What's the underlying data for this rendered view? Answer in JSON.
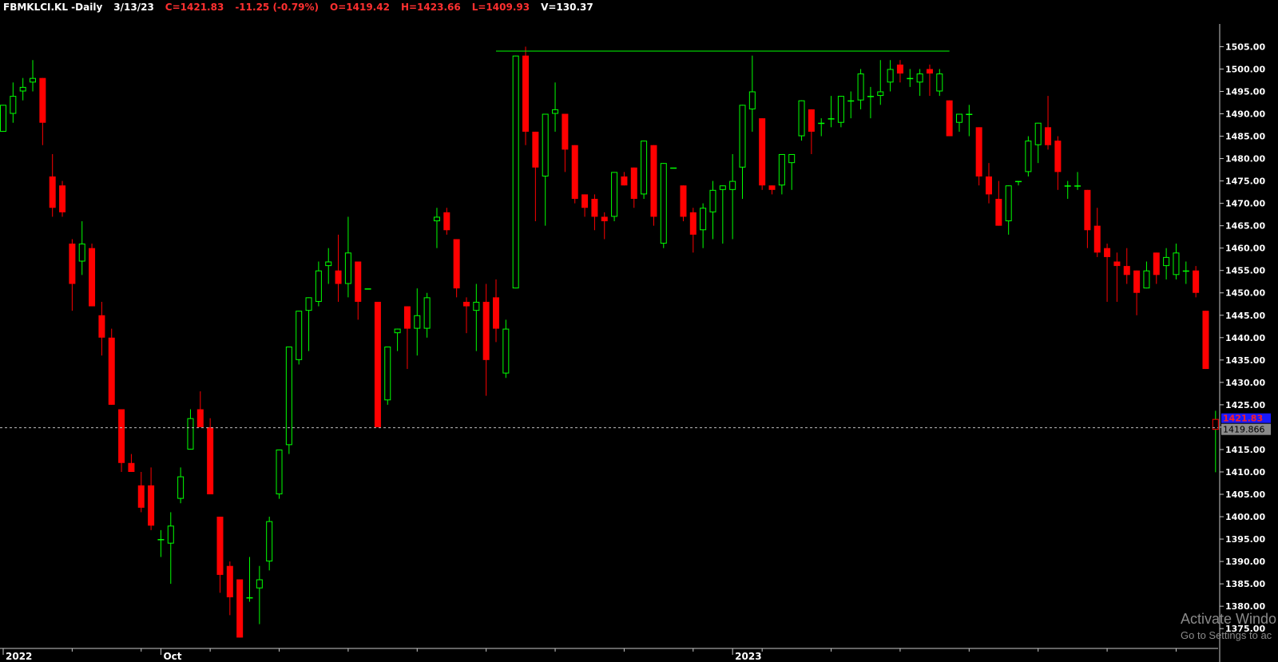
{
  "header": {
    "symbol": "FBMKLCI.KL -Daily",
    "date": "3/13/23",
    "close": "C=1421.83",
    "change": "-11.25 (-0.79%)",
    "open": "O=1419.42",
    "high": "H=1423.66",
    "low": "L=1409.93",
    "volume": "V=130.37"
  },
  "colors": {
    "background": "#000000",
    "up": "#00ff00",
    "down": "#ff0000",
    "resistance_line": "#00ff00",
    "text_white": "#ffffff",
    "text_red": "#ff3030",
    "price_badge_bg": "#8b8b8b"
  },
  "price_badges": {
    "last": "1421.83",
    "crosshair": "1419.866"
  },
  "watermark": {
    "line1": "Activate Windo",
    "line2": "Go to Settings to ac"
  },
  "chart_data": {
    "type": "candlestick",
    "ylim": [
      1372,
      1509
    ],
    "y_ticks": [
      "1375.00",
      "1380.00",
      "1385.00",
      "1390.00",
      "1395.00",
      "1400.00",
      "1405.00",
      "1410.00",
      "1415.00",
      "1420.00",
      "1425.00",
      "1430.00",
      "1435.00",
      "1440.00",
      "1445.00",
      "1450.00",
      "1455.00",
      "1460.00",
      "1465.00",
      "1470.00",
      "1475.00",
      "1480.00",
      "1485.00",
      "1490.00",
      "1495.00",
      "1500.00",
      "1505.00"
    ],
    "x_labels": [
      {
        "index": 0,
        "label": "2022"
      },
      {
        "index": 16,
        "label": "Oct"
      },
      {
        "index": 74,
        "label": "2023"
      }
    ],
    "horizontal_line": {
      "from_index": 50,
      "to_index": 96,
      "value": 1504
    },
    "crosshair_value": 1419.866,
    "candles": [
      {
        "o": 1486,
        "h": 1492,
        "l": 1486,
        "c": 1492
      },
      {
        "o": 1490,
        "h": 1497,
        "l": 1488,
        "c": 1494
      },
      {
        "o": 1495,
        "h": 1498,
        "l": 1493,
        "c": 1496
      },
      {
        "o": 1497,
        "h": 1502,
        "l": 1495,
        "c": 1498
      },
      {
        "o": 1498,
        "h": 1498,
        "l": 1483,
        "c": 1488
      },
      {
        "o": 1476,
        "h": 1481,
        "l": 1467,
        "c": 1469
      },
      {
        "o": 1474,
        "h": 1475,
        "l": 1467,
        "c": 1468
      },
      {
        "o": 1461,
        "h": 1462,
        "l": 1446,
        "c": 1452
      },
      {
        "o": 1457,
        "h": 1466,
        "l": 1454,
        "c": 1461
      },
      {
        "o": 1460,
        "h": 1461,
        "l": 1447,
        "c": 1447
      },
      {
        "o": 1445,
        "h": 1448,
        "l": 1436,
        "c": 1440
      },
      {
        "o": 1440,
        "h": 1442,
        "l": 1425,
        "c": 1425
      },
      {
        "o": 1424,
        "h": 1424,
        "l": 1410,
        "c": 1412
      },
      {
        "o": 1412,
        "h": 1414,
        "l": 1410,
        "c": 1410
      },
      {
        "o": 1407,
        "h": 1410,
        "l": 1401,
        "c": 1402
      },
      {
        "o": 1407,
        "h": 1411,
        "l": 1397,
        "c": 1398
      },
      {
        "o": 1395,
        "h": 1397,
        "l": 1391,
        "c": 1395
      },
      {
        "o": 1394,
        "h": 1401,
        "l": 1385,
        "c": 1398
      },
      {
        "o": 1404,
        "h": 1411,
        "l": 1403,
        "c": 1409
      },
      {
        "o": 1415,
        "h": 1424,
        "l": 1415,
        "c": 1422
      },
      {
        "o": 1424,
        "h": 1428,
        "l": 1420,
        "c": 1420
      },
      {
        "o": 1420,
        "h": 1422,
        "l": 1405,
        "c": 1405
      },
      {
        "o": 1400,
        "h": 1400,
        "l": 1383,
        "c": 1387
      },
      {
        "o": 1389,
        "h": 1390,
        "l": 1378,
        "c": 1382
      },
      {
        "o": 1386,
        "h": 1386,
        "l": 1373,
        "c": 1373
      },
      {
        "o": 1382,
        "h": 1391,
        "l": 1381,
        "c": 1382
      },
      {
        "o": 1384,
        "h": 1389,
        "l": 1376,
        "c": 1386
      },
      {
        "o": 1390,
        "h": 1400,
        "l": 1388,
        "c": 1399
      },
      {
        "o": 1405,
        "h": 1415,
        "l": 1404,
        "c": 1415
      },
      {
        "o": 1416,
        "h": 1438,
        "l": 1414,
        "c": 1438
      },
      {
        "o": 1435,
        "h": 1446,
        "l": 1434,
        "c": 1446
      },
      {
        "o": 1446,
        "h": 1449,
        "l": 1437,
        "c": 1449
      },
      {
        "o": 1448,
        "h": 1457,
        "l": 1447,
        "c": 1455
      },
      {
        "o": 1456,
        "h": 1460,
        "l": 1452,
        "c": 1457
      },
      {
        "o": 1455,
        "h": 1463,
        "l": 1448,
        "c": 1452
      },
      {
        "o": 1452,
        "h": 1467,
        "l": 1449,
        "c": 1459
      },
      {
        "o": 1457,
        "h": 1457,
        "l": 1444,
        "c": 1448
      },
      {
        "o": 1451,
        "h": 1451,
        "l": 1451,
        "c": 1451
      },
      {
        "o": 1448,
        "h": 1448,
        "l": 1420,
        "c": 1420
      },
      {
        "o": 1426,
        "h": 1438,
        "l": 1425,
        "c": 1438
      },
      {
        "o": 1441,
        "h": 1442,
        "l": 1437,
        "c": 1442
      },
      {
        "o": 1447,
        "h": 1447,
        "l": 1433,
        "c": 1442
      },
      {
        "o": 1442,
        "h": 1451,
        "l": 1436,
        "c": 1445
      },
      {
        "o": 1442,
        "h": 1450,
        "l": 1440,
        "c": 1449
      },
      {
        "o": 1466,
        "h": 1469,
        "l": 1460,
        "c": 1467
      },
      {
        "o": 1468,
        "h": 1469,
        "l": 1463,
        "c": 1464
      },
      {
        "o": 1462,
        "h": 1462,
        "l": 1449,
        "c": 1451
      },
      {
        "o": 1448,
        "h": 1449,
        "l": 1441,
        "c": 1447
      },
      {
        "o": 1446,
        "h": 1452,
        "l": 1437,
        "c": 1448
      },
      {
        "o": 1448,
        "h": 1452,
        "l": 1427,
        "c": 1435
      },
      {
        "o": 1449,
        "h": 1453,
        "l": 1439,
        "c": 1442
      },
      {
        "o": 1432,
        "h": 1444,
        "l": 1431,
        "c": 1442
      },
      {
        "o": 1451,
        "h": 1503,
        "l": 1451,
        "c": 1503
      },
      {
        "o": 1503,
        "h": 1505,
        "l": 1483,
        "c": 1486
      },
      {
        "o": 1486,
        "h": 1486,
        "l": 1466,
        "c": 1478
      },
      {
        "o": 1476,
        "h": 1490,
        "l": 1465,
        "c": 1490
      },
      {
        "o": 1490,
        "h": 1497,
        "l": 1486,
        "c": 1491
      },
      {
        "o": 1490,
        "h": 1490,
        "l": 1477,
        "c": 1482
      },
      {
        "o": 1483,
        "h": 1483,
        "l": 1470,
        "c": 1471
      },
      {
        "o": 1472,
        "h": 1472,
        "l": 1467,
        "c": 1469
      },
      {
        "o": 1471,
        "h": 1472,
        "l": 1464,
        "c": 1467
      },
      {
        "o": 1467,
        "h": 1468,
        "l": 1462,
        "c": 1466
      },
      {
        "o": 1467,
        "h": 1477,
        "l": 1466,
        "c": 1477
      },
      {
        "o": 1476,
        "h": 1477,
        "l": 1474,
        "c": 1474
      },
      {
        "o": 1478,
        "h": 1478,
        "l": 1469,
        "c": 1471
      },
      {
        "o": 1472,
        "h": 1484,
        "l": 1471,
        "c": 1484
      },
      {
        "o": 1483,
        "h": 1483,
        "l": 1465,
        "c": 1467
      },
      {
        "o": 1461,
        "h": 1479,
        "l": 1460,
        "c": 1479
      },
      {
        "o": 1478,
        "h": 1478,
        "l": 1478,
        "c": 1478
      },
      {
        "o": 1474,
        "h": 1474,
        "l": 1466,
        "c": 1467
      },
      {
        "o": 1468,
        "h": 1469,
        "l": 1459,
        "c": 1463
      },
      {
        "o": 1464,
        "h": 1470,
        "l": 1460,
        "c": 1469
      },
      {
        "o": 1468,
        "h": 1475,
        "l": 1462,
        "c": 1473
      },
      {
        "o": 1473,
        "h": 1474,
        "l": 1461,
        "c": 1474
      },
      {
        "o": 1473,
        "h": 1481,
        "l": 1462,
        "c": 1475
      },
      {
        "o": 1478,
        "h": 1492,
        "l": 1471,
        "c": 1492
      },
      {
        "o": 1491,
        "h": 1503,
        "l": 1486,
        "c": 1495
      },
      {
        "o": 1489,
        "h": 1489,
        "l": 1473,
        "c": 1474
      },
      {
        "o": 1474,
        "h": 1474,
        "l": 1472,
        "c": 1473
      },
      {
        "o": 1474,
        "h": 1481,
        "l": 1472,
        "c": 1481
      },
      {
        "o": 1479,
        "h": 1481,
        "l": 1473,
        "c": 1481
      },
      {
        "o": 1485,
        "h": 1493,
        "l": 1484,
        "c": 1493
      },
      {
        "o": 1491,
        "h": 1491,
        "l": 1481,
        "c": 1486
      },
      {
        "o": 1488,
        "h": 1489,
        "l": 1485,
        "c": 1488
      },
      {
        "o": 1489,
        "h": 1494,
        "l": 1487,
        "c": 1489
      },
      {
        "o": 1488,
        "h": 1494,
        "l": 1487,
        "c": 1494
      },
      {
        "o": 1493,
        "h": 1495,
        "l": 1489,
        "c": 1493
      },
      {
        "o": 1493,
        "h": 1500,
        "l": 1491,
        "c": 1499
      },
      {
        "o": 1494,
        "h": 1496,
        "l": 1489,
        "c": 1494
      },
      {
        "o": 1494,
        "h": 1502,
        "l": 1492,
        "c": 1495
      },
      {
        "o": 1497,
        "h": 1502,
        "l": 1495,
        "c": 1500
      },
      {
        "o": 1501,
        "h": 1502,
        "l": 1497,
        "c": 1499
      },
      {
        "o": 1498,
        "h": 1500,
        "l": 1496,
        "c": 1498
      },
      {
        "o": 1497,
        "h": 1500,
        "l": 1494,
        "c": 1499
      },
      {
        "o": 1500,
        "h": 1501,
        "l": 1494,
        "c": 1499
      },
      {
        "o": 1495,
        "h": 1500,
        "l": 1494,
        "c": 1499
      },
      {
        "o": 1493,
        "h": 1493,
        "l": 1485,
        "c": 1485
      },
      {
        "o": 1488,
        "h": 1490,
        "l": 1486,
        "c": 1490
      },
      {
        "o": 1490,
        "h": 1492,
        "l": 1485,
        "c": 1490
      },
      {
        "o": 1487,
        "h": 1487,
        "l": 1474,
        "c": 1476
      },
      {
        "o": 1476,
        "h": 1479,
        "l": 1470,
        "c": 1472
      },
      {
        "o": 1471,
        "h": 1475,
        "l": 1465,
        "c": 1465
      },
      {
        "o": 1466,
        "h": 1474,
        "l": 1463,
        "c": 1474
      },
      {
        "o": 1475,
        "h": 1475,
        "l": 1474,
        "c": 1475
      },
      {
        "o": 1477,
        "h": 1485,
        "l": 1476,
        "c": 1484
      },
      {
        "o": 1483,
        "h": 1488,
        "l": 1479,
        "c": 1488
      },
      {
        "o": 1487,
        "h": 1494,
        "l": 1482,
        "c": 1483
      },
      {
        "o": 1484,
        "h": 1485,
        "l": 1473,
        "c": 1477
      },
      {
        "o": 1474,
        "h": 1475,
        "l": 1471,
        "c": 1474
      },
      {
        "o": 1474,
        "h": 1477,
        "l": 1473,
        "c": 1474
      },
      {
        "o": 1473,
        "h": 1473,
        "l": 1460,
        "c": 1464
      },
      {
        "o": 1465,
        "h": 1469,
        "l": 1458,
        "c": 1459
      },
      {
        "o": 1460,
        "h": 1461,
        "l": 1448,
        "c": 1458
      },
      {
        "o": 1457,
        "h": 1459,
        "l": 1448,
        "c": 1456
      },
      {
        "o": 1456,
        "h": 1460,
        "l": 1452,
        "c": 1454
      },
      {
        "o": 1455,
        "h": 1455,
        "l": 1445,
        "c": 1450
      },
      {
        "o": 1451,
        "h": 1457,
        "l": 1451,
        "c": 1455
      },
      {
        "o": 1459,
        "h": 1459,
        "l": 1452,
        "c": 1454
      },
      {
        "o": 1456,
        "h": 1460,
        "l": 1453,
        "c": 1458
      },
      {
        "o": 1454,
        "h": 1461,
        "l": 1453,
        "c": 1459
      },
      {
        "o": 1455,
        "h": 1457,
        "l": 1452,
        "c": 1455
      },
      {
        "o": 1455,
        "h": 1456,
        "l": 1449,
        "c": 1450
      },
      {
        "o": 1446,
        "h": 1446,
        "l": 1433,
        "c": 1433
      },
      {
        "o": 1419.42,
        "h": 1423.66,
        "l": 1409.93,
        "c": 1421.83
      }
    ]
  }
}
